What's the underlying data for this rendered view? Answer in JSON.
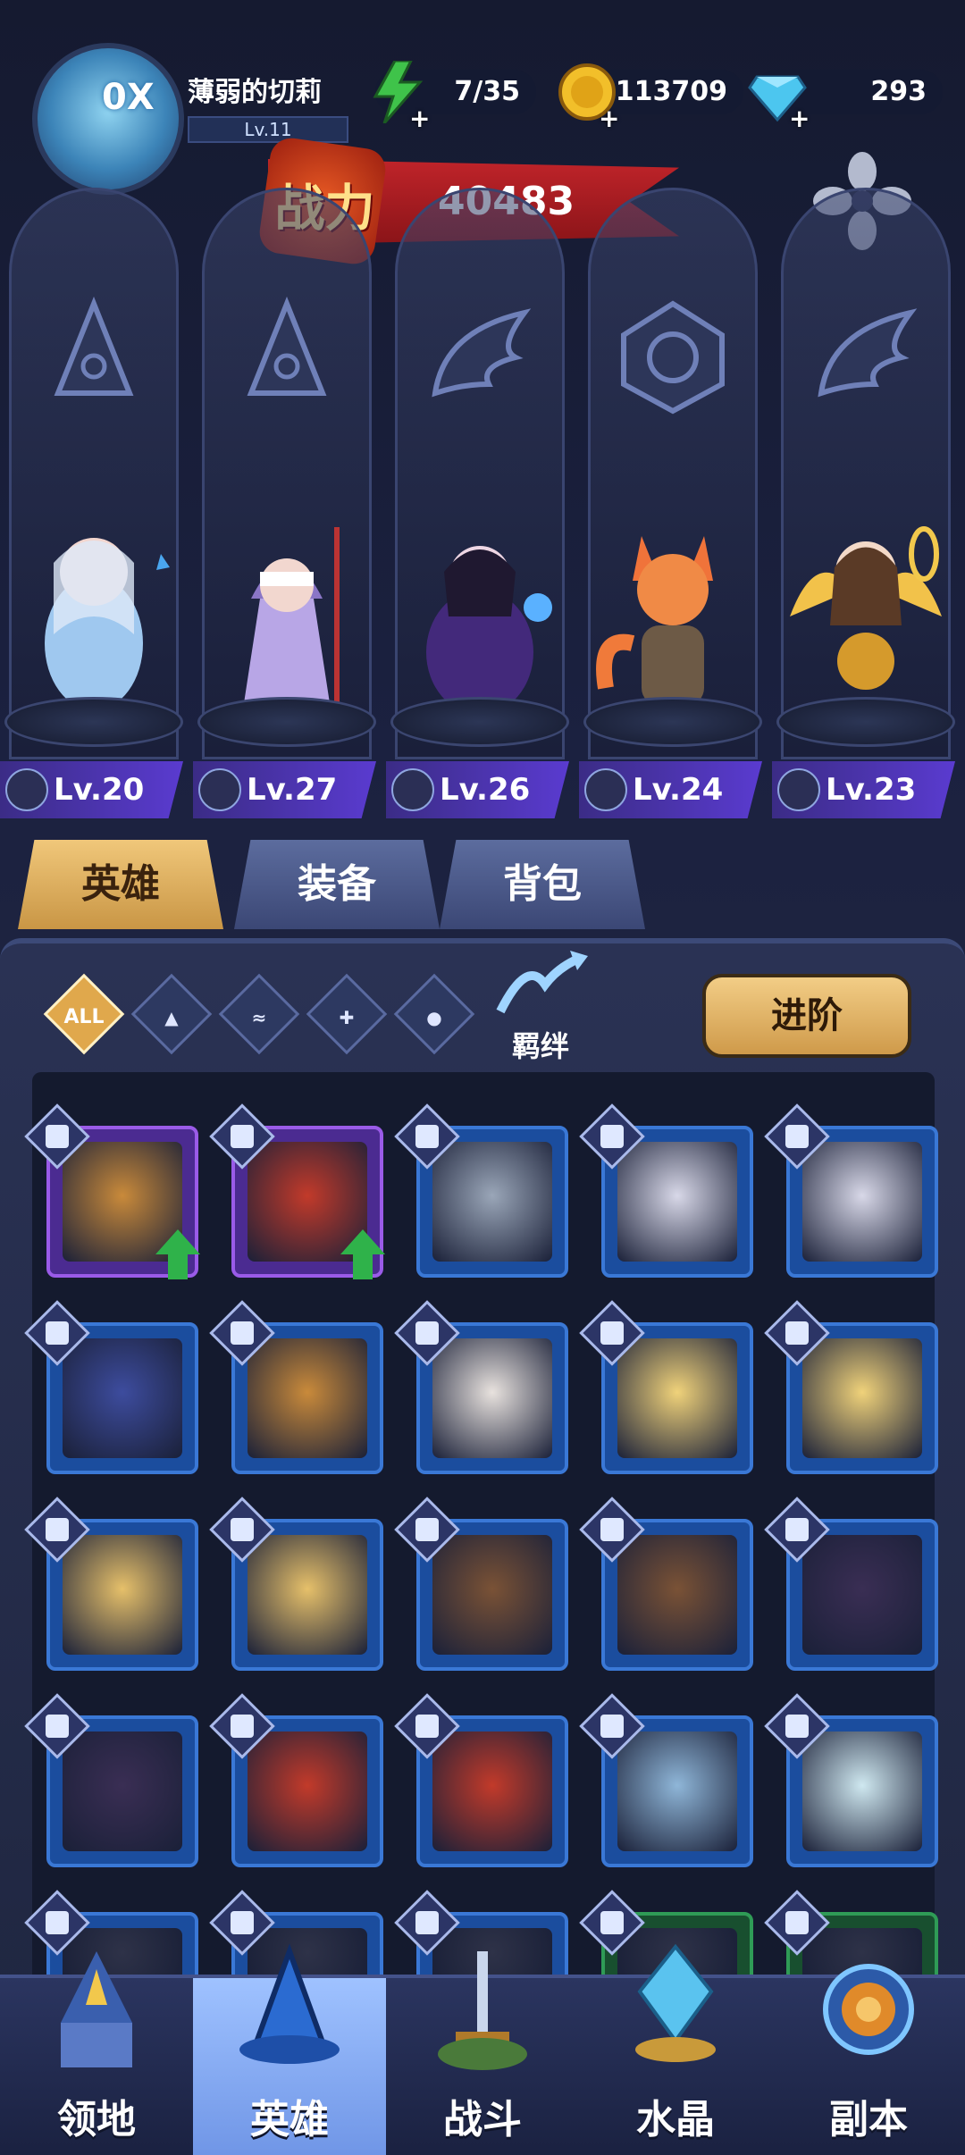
{
  "player": {
    "name": "薄弱的切莉",
    "level": "Lv.11",
    "speed_badge": "0X"
  },
  "resources": {
    "energy": "7/35",
    "gold": "113709",
    "gems": "293",
    "plus": "+"
  },
  "power": {
    "label": "战力",
    "value": "40483"
  },
  "heroes": [
    {
      "level": "Lv.20",
      "class": "mage"
    },
    {
      "level": "Lv.27",
      "class": "mage"
    },
    {
      "level": "Lv.26",
      "class": "wing"
    },
    {
      "level": "Lv.24",
      "class": "beast"
    },
    {
      "level": "Lv.23",
      "class": "wing"
    }
  ],
  "column_emblems": [
    "hat-icon",
    "hat-icon",
    "wing-icon",
    "beast-icon",
    "wing-icon"
  ],
  "tabs": [
    {
      "label": "英雄"
    },
    {
      "label": "装备"
    },
    {
      "label": "背包"
    }
  ],
  "filters": {
    "all": "ALL",
    "bond": "羁绊",
    "advance": "进阶"
  },
  "hero_cards": [
    {
      "class": "mage",
      "rarity": "purple",
      "upgrade": true
    },
    {
      "class": "tool",
      "rarity": "purple",
      "upgrade": true
    },
    {
      "class": "mage",
      "rarity": "blue",
      "upgrade": false
    },
    {
      "class": "mage",
      "rarity": "blue",
      "upgrade": false
    },
    {
      "class": "mage",
      "rarity": "blue",
      "upgrade": false
    },
    {
      "class": "mage",
      "rarity": "blue",
      "upgrade": false
    },
    {
      "class": "mage",
      "rarity": "blue",
      "upgrade": false
    },
    {
      "class": "wing",
      "rarity": "blue",
      "upgrade": false
    },
    {
      "class": "wing",
      "rarity": "blue",
      "upgrade": false
    },
    {
      "class": "wing",
      "rarity": "blue",
      "upgrade": false
    },
    {
      "class": "wing",
      "rarity": "blue",
      "upgrade": false
    },
    {
      "class": "wing",
      "rarity": "blue",
      "upgrade": false
    },
    {
      "class": "wing",
      "rarity": "blue",
      "upgrade": false
    },
    {
      "class": "wing",
      "rarity": "blue",
      "upgrade": false
    },
    {
      "class": "wing",
      "rarity": "blue",
      "upgrade": false
    },
    {
      "class": "wing",
      "rarity": "blue",
      "upgrade": false
    },
    {
      "class": "tool",
      "rarity": "blue",
      "upgrade": false
    },
    {
      "class": "tool",
      "rarity": "blue",
      "upgrade": false
    },
    {
      "class": "tool",
      "rarity": "blue",
      "upgrade": false
    },
    {
      "class": "tool",
      "rarity": "blue",
      "upgrade": false
    },
    {
      "class": "beast",
      "rarity": "blue",
      "upgrade": false
    },
    {
      "class": "beast",
      "rarity": "blue",
      "upgrade": false
    },
    {
      "class": "beast",
      "rarity": "blue",
      "upgrade": false
    },
    {
      "class": "wing",
      "rarity": "green",
      "upgrade": false
    },
    {
      "class": "wing",
      "rarity": "green",
      "upgrade": false
    }
  ],
  "nav": [
    {
      "label": "领地",
      "icon": "castle-icon"
    },
    {
      "label": "英雄",
      "icon": "hero-hat-icon",
      "active": true
    },
    {
      "label": "战斗",
      "icon": "sword-icon"
    },
    {
      "label": "水晶",
      "icon": "crystal-icon"
    },
    {
      "label": "副本",
      "icon": "portal-icon"
    }
  ],
  "colors": {
    "accent_gold": "#e0a84c",
    "power_red": "#c0242a",
    "card_blue": "#3a78d6",
    "card_purple": "#9a5be8"
  }
}
